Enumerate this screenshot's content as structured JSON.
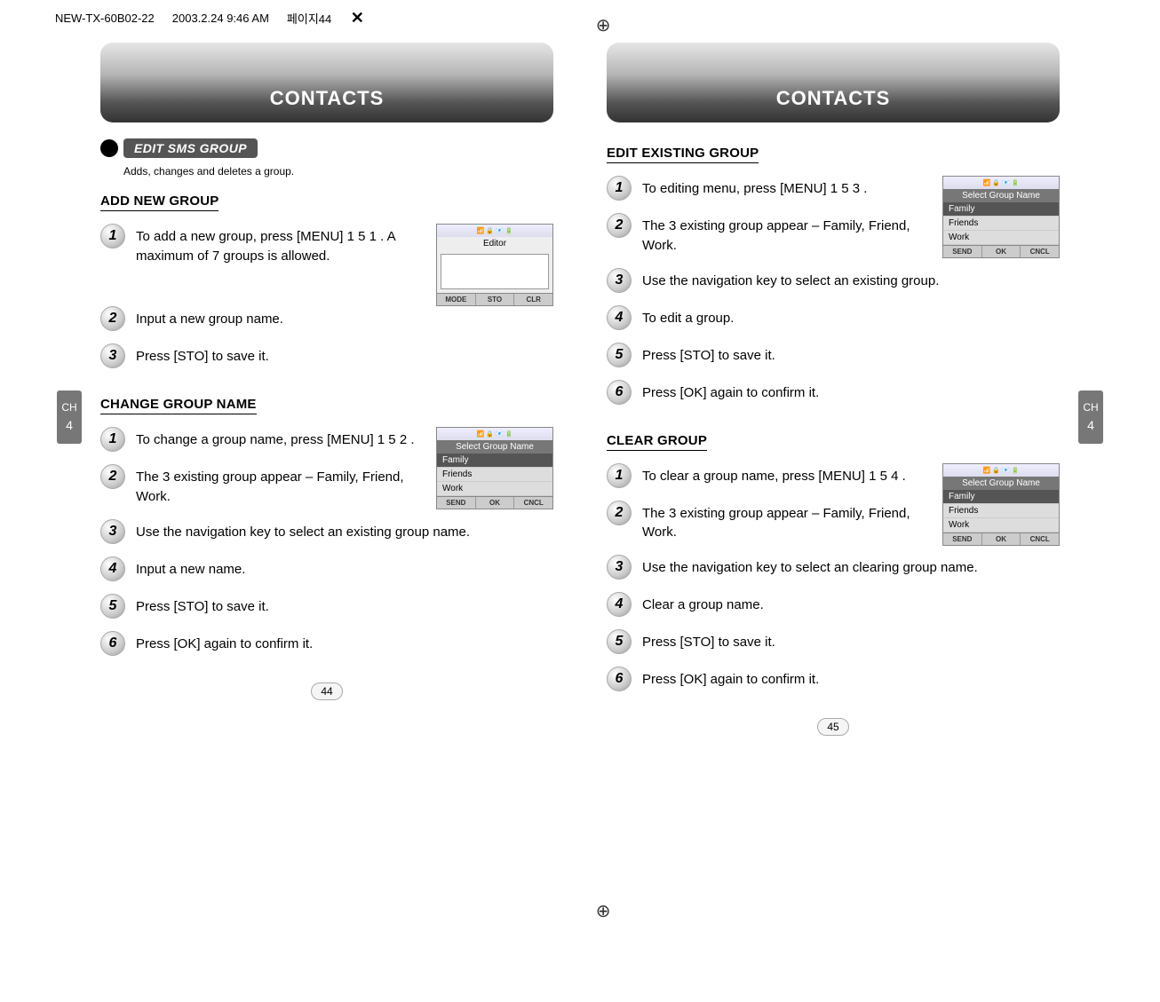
{
  "meta": {
    "filename": "NEW-TX-60B02-22",
    "timestamp": "2003.2.24 9:46 AM",
    "page_marker": "페이지44"
  },
  "tabs": {
    "label_ch": "CH",
    "label_num": "4"
  },
  "left": {
    "header": "CONTACTS",
    "section_pill": "EDIT SMS GROUP",
    "section_caption": "Adds, changes and deletes a group.",
    "sub1": {
      "title": "ADD NEW GROUP",
      "steps": [
        "To add a new group, press [MENU] 1 5 1 . A maximum of 7 groups is allowed.",
        "Input a new group name.",
        "Press [STO] to save it."
      ],
      "phone": {
        "title": "Editor",
        "soft": [
          "MODE",
          "STO",
          "CLR"
        ]
      }
    },
    "sub2": {
      "title": "CHANGE GROUP NAME",
      "steps": [
        "To change a group name, press [MENU] 1 5 2 .",
        "The 3 existing group appear – Family, Friend, Work.",
        "Use the navigation key to select an existing group name.",
        "Input a new name.",
        "Press [STO] to save it.",
        "Press [OK] again to confirm it."
      ],
      "phone": {
        "title": "Select Group Name",
        "items": [
          "Family",
          "Friends",
          "Work"
        ],
        "soft": [
          "SEND",
          "OK",
          "CNCL"
        ]
      }
    },
    "page_number": "44"
  },
  "right": {
    "header": "CONTACTS",
    "sub1": {
      "title": "EDIT EXISTING GROUP",
      "steps": [
        "To editing menu, press [MENU] 1 5 3 .",
        "The 3 existing group appear – Family, Friend, Work.",
        "Use the navigation key to select an existing group.",
        "To edit a group.",
        "Press [STO] to save it.",
        "Press [OK] again to confirm it."
      ],
      "phone": {
        "title": "Select Group Name",
        "items": [
          "Family",
          "Friends",
          "Work"
        ],
        "soft": [
          "SEND",
          "OK",
          "CNCL"
        ]
      }
    },
    "sub2": {
      "title": "CLEAR GROUP",
      "steps": [
        "To clear a group name, press [MENU] 1 5 4 .",
        "The 3 existing group appear – Family, Friend, Work.",
        "Use the navigation key to select an clearing group name.",
        "Clear a group name.",
        "Press [STO] to save it.",
        "Press [OK] again to confirm it."
      ],
      "phone": {
        "title": "Select Group Name",
        "items": [
          "Family",
          "Friends",
          "Work"
        ],
        "soft": [
          "SEND",
          "OK",
          "CNCL"
        ]
      }
    },
    "page_number": "45"
  },
  "status_icons": "▮◧◨◩"
}
